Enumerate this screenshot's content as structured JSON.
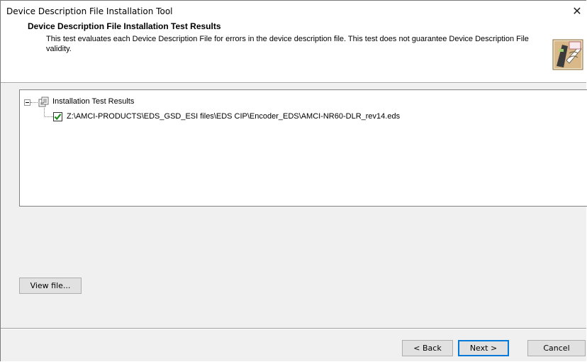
{
  "window": {
    "title": "Device Description File Installation Tool",
    "close_glyph": "✕"
  },
  "header": {
    "title": "Device Description File Installation Test Results",
    "description": "This test evaluates each Device Description File for errors in the device description file. This test does not guarantee Device Description File validity.",
    "icon": "wizard-icon"
  },
  "tree": {
    "root": {
      "label": "Installation Test Results",
      "expanded": true,
      "icon": "test-results-icon"
    },
    "items": [
      {
        "label": "Z:\\AMCI-PRODUCTS\\EDS_GSD_ESI files\\EDS CIP\\Encoder_EDS\\AMCI-NR60-DLR_rev14.eds",
        "checked": true,
        "check_color": "#1a8f1a"
      }
    ]
  },
  "buttons": {
    "view_file": "View file...",
    "back": "< Back",
    "next": "Next >",
    "cancel": "Cancel"
  }
}
